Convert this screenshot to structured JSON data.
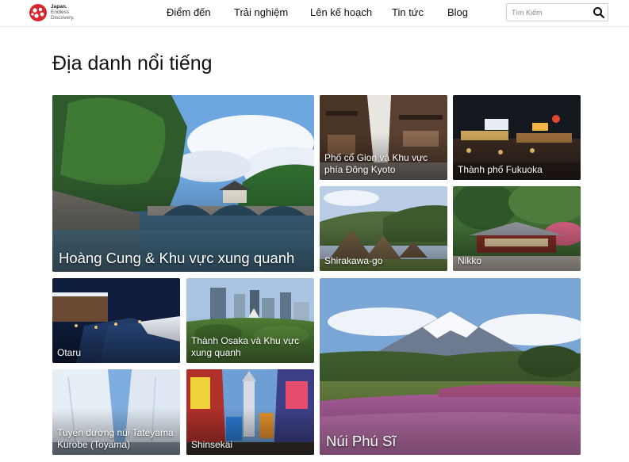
{
  "header": {
    "logo": {
      "line1": "Japan.",
      "line2": "Endless",
      "line3": "Discovery."
    },
    "nav": [
      {
        "label": "Điểm đến"
      },
      {
        "label": "Trải nghiệm"
      },
      {
        "label": "Lên kế hoạch"
      },
      {
        "label": "Tin tức"
      },
      {
        "label": "Blog"
      }
    ],
    "search": {
      "placeholder": "Tìm Kiếm",
      "icon": "search-icon"
    }
  },
  "main": {
    "title": "Địa danh nổi tiếng",
    "tiles": [
      {
        "label": "Hoàng Cung & Khu vực xung quanh"
      },
      {
        "label": "Phố cổ Gion và Khu vực phía Đông Kyoto"
      },
      {
        "label": "Thành phố Fukuoka"
      },
      {
        "label": "Shirakawa-go"
      },
      {
        "label": "Nikko"
      },
      {
        "label": "Otaru"
      },
      {
        "label": "Thành Osaka và Khu vực xung quanh"
      },
      {
        "label": "Núi Phú Sĩ"
      },
      {
        "label": "Tuyến đường núi Tateyama Kurobe (Toyama)"
      },
      {
        "label": "Shinsekai"
      }
    ]
  },
  "colors": {
    "brand_red": "#d7282f",
    "text": "#111111",
    "border": "#e9e9e9"
  }
}
